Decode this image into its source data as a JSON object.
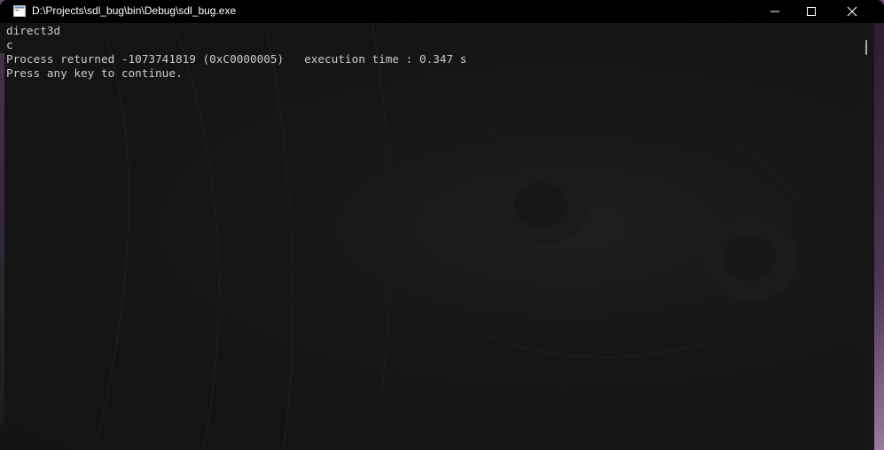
{
  "window": {
    "title": "D:\\Projects\\sdl_bug\\bin\\Debug\\sdl_bug.exe",
    "icon": "console-app-icon",
    "controls": {
      "minimize_icon": "minimize-icon",
      "maximize_icon": "maximize-icon",
      "close_icon": "close-icon"
    }
  },
  "console": {
    "lines": [
      "direct3d",
      "c",
      "Process returned -1073741819 (0xC0000005)   execution time : 0.347 s",
      "Press any key to continue."
    ],
    "text_color": "#cccccc",
    "background_color": "#131313"
  },
  "colors": {
    "titlebar": "#000000",
    "desktop_accent": "#8a6a90"
  }
}
